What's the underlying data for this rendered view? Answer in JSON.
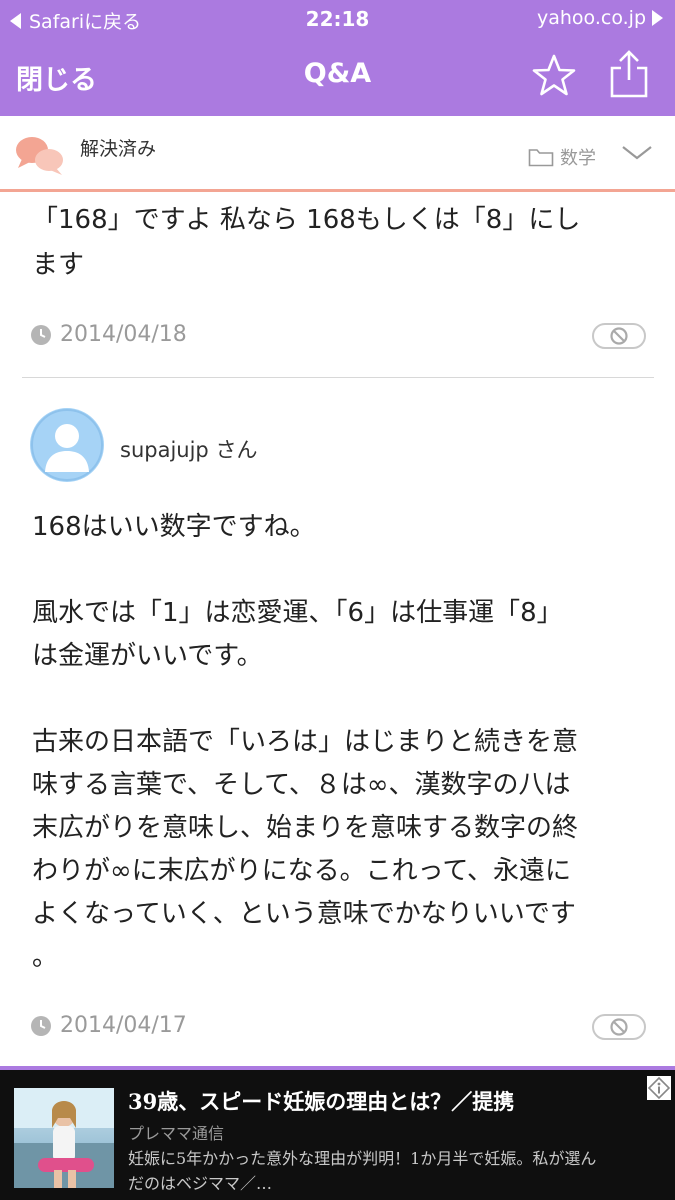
{
  "status_bar": {
    "back_label": "Safariに戻る",
    "time": "22:18",
    "site": "yahoo.co.jp"
  },
  "nav": {
    "close_label": "閉じる",
    "title": "Q&A",
    "star_icon": "star-icon",
    "share_icon": "share-icon"
  },
  "question_header": {
    "status": "解決済み",
    "category": "数学"
  },
  "answers": [
    {
      "text_lines": [
        "「168」ですよ 私なら 168もしくは「8」にし",
        "ます"
      ],
      "date": "2014/04/18"
    },
    {
      "username": "supajujp",
      "honorific": "さん",
      "paragraphs": [
        [
          "168はいい数字ですね。"
        ],
        [
          "風水では「1」は恋愛運、「6」は仕事運「8」",
          "は金運がいいです。"
        ],
        [
          "古来の日本語で「いろは」はじまりと続きを意",
          "味する言葉で、そして、８は∞、漢数字の八は",
          "末広がりを意味し、始まりを意味する数字の終",
          "わりが∞に末広がりになる。これって、永遠に",
          "よくなっていく、という意味でかなりいいです",
          "。"
        ]
      ],
      "date": "2014/04/17"
    }
  ],
  "ad": {
    "headline": "39歳、スピード妊娠の理由とは？／提携",
    "source": "プレママ通信",
    "desc_lines": [
      "妊娠に5年かかった意外な理由が判明！1か月半で妊娠。私が選ん",
      "だのはベジママ／…"
    ]
  },
  "colors": {
    "brand_purple": "#ab7ae0",
    "accent_salmon": "#f3a593",
    "ad_background": "#0f0f0f"
  }
}
